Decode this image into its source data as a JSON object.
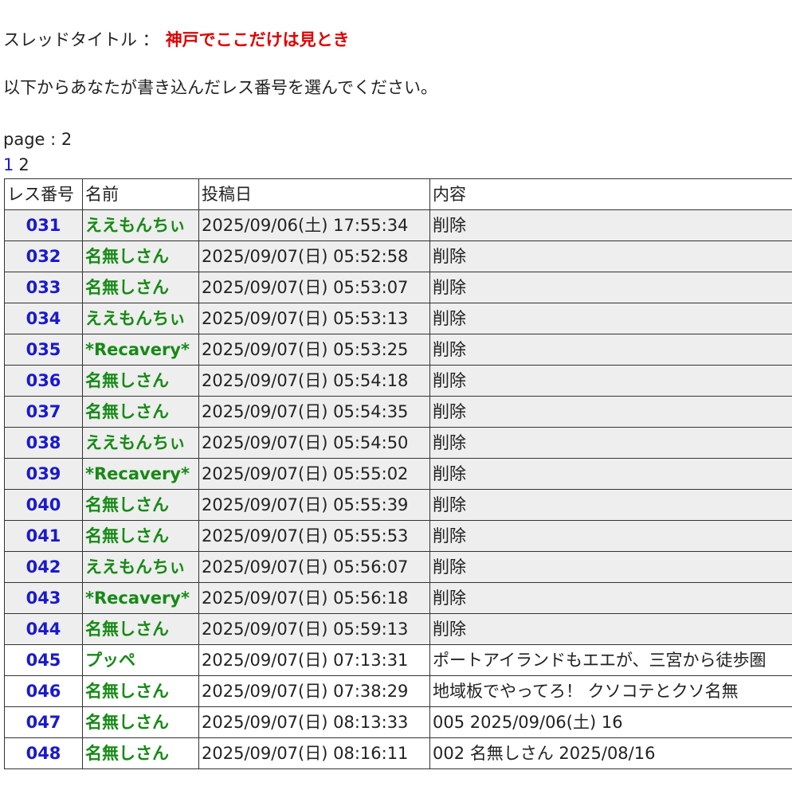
{
  "thread": {
    "label": "スレッドタイトル ：",
    "title": "神戸でここだけは見とき"
  },
  "instruction": "以下からあなたが書き込んだレス番号を選んでください。",
  "page_info": "page : 2",
  "pager": {
    "link": "1",
    "current": "2"
  },
  "table": {
    "headers": [
      "レス番号",
      "名前",
      "投稿日",
      "内容"
    ],
    "rows": [
      {
        "num": "031",
        "name": "ええもんちぃ",
        "date": "2025/09/06(土) 17:55:34",
        "content": "削除",
        "deleted": true
      },
      {
        "num": "032",
        "name": "名無しさん",
        "date": "2025/09/07(日) 05:52:58",
        "content": "削除",
        "deleted": true
      },
      {
        "num": "033",
        "name": "名無しさん",
        "date": "2025/09/07(日) 05:53:07",
        "content": "削除",
        "deleted": true
      },
      {
        "num": "034",
        "name": "ええもんちぃ",
        "date": "2025/09/07(日) 05:53:13",
        "content": "削除",
        "deleted": true
      },
      {
        "num": "035",
        "name": "*Recavery*",
        "date": "2025/09/07(日) 05:53:25",
        "content": "削除",
        "deleted": true
      },
      {
        "num": "036",
        "name": "名無しさん",
        "date": "2025/09/07(日) 05:54:18",
        "content": "削除",
        "deleted": true
      },
      {
        "num": "037",
        "name": "名無しさん",
        "date": "2025/09/07(日) 05:54:35",
        "content": "削除",
        "deleted": true
      },
      {
        "num": "038",
        "name": "ええもんちぃ",
        "date": "2025/09/07(日) 05:54:50",
        "content": "削除",
        "deleted": true
      },
      {
        "num": "039",
        "name": "*Recavery*",
        "date": "2025/09/07(日) 05:55:02",
        "content": "削除",
        "deleted": true
      },
      {
        "num": "040",
        "name": "名無しさん",
        "date": "2025/09/07(日) 05:55:39",
        "content": "削除",
        "deleted": true
      },
      {
        "num": "041",
        "name": "名無しさん",
        "date": "2025/09/07(日) 05:55:53",
        "content": "削除",
        "deleted": true
      },
      {
        "num": "042",
        "name": "ええもんちぃ",
        "date": "2025/09/07(日) 05:56:07",
        "content": "削除",
        "deleted": true
      },
      {
        "num": "043",
        "name": "*Recavery*",
        "date": "2025/09/07(日) 05:56:18",
        "content": "削除",
        "deleted": true
      },
      {
        "num": "044",
        "name": "名無しさん",
        "date": "2025/09/07(日) 05:59:13",
        "content": "削除",
        "deleted": true
      },
      {
        "num": "045",
        "name": "プッペ",
        "date": "2025/09/07(日) 07:13:31",
        "content": "ポートアイランドもエエが、三宮から徒歩圏",
        "deleted": false
      },
      {
        "num": "046",
        "name": "名無しさん",
        "date": "2025/09/07(日) 07:38:29",
        "content": "地域板でやってろ！ クソコテとクソ名無",
        "deleted": false
      },
      {
        "num": "047",
        "name": "名無しさん",
        "date": "2025/09/07(日) 08:13:33",
        "content": "005 2025/09/06(土) 16",
        "deleted": false
      },
      {
        "num": "048",
        "name": "名無しさん",
        "date": "2025/09/07(日) 08:16:11",
        "content": "002 名無しさん 2025/08/16",
        "deleted": false
      }
    ]
  },
  "colors": {
    "title_red": "#e00000",
    "link_blue": "#1a1acc",
    "name_green": "#168a16",
    "deleted_row_bg": "#eeeeee"
  }
}
